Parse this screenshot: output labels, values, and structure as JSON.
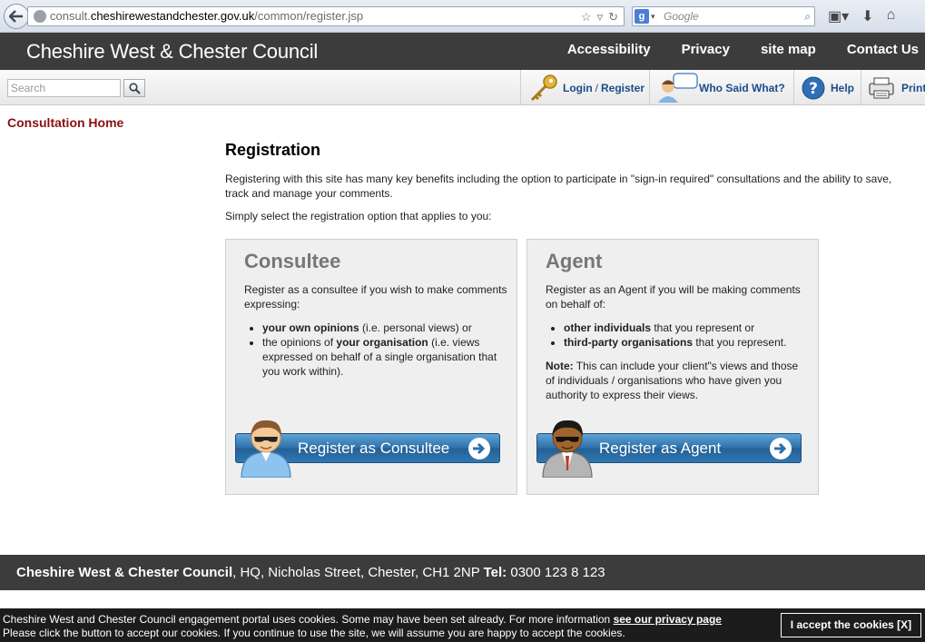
{
  "browser": {
    "url_prefix": "consult.",
    "url_host": "cheshirewestandchester.gov.uk",
    "url_path": "/common/register.jsp",
    "search_engine_letter": "g",
    "search_placeholder": "Google"
  },
  "header": {
    "site_title": "Cheshire West & Chester Council",
    "nav": [
      "Accessibility",
      "Privacy",
      "site map",
      "Contact Us"
    ]
  },
  "toolbar": {
    "search_placeholder": "Search",
    "login": "Login",
    "login_sep": "/",
    "register": "Register",
    "who_said": "Who Said What?",
    "help": "Help",
    "print": "Print"
  },
  "left_nav": {
    "home_link": "Consultation Home"
  },
  "main": {
    "title": "Registration",
    "intro": "Registering with this site has many key benefits including the option to participate in \"sign-in required\" consultations and the ability to save, track and manage your comments.",
    "instruction": "Simply select the registration option that applies to you:"
  },
  "consultee": {
    "heading": "Consultee",
    "intro": "Register as a consultee if you wish to make comments expressing:",
    "bullet1_bold": "your own opinions",
    "bullet1_rest": " (i.e. personal views) or",
    "bullet2_pre": "the opinions of ",
    "bullet2_bold": "your organisation",
    "bullet2_rest": " (i.e. views expressed on behalf of a single organisation that you work within).",
    "button": "Register as Consultee"
  },
  "agent": {
    "heading": "Agent",
    "intro": "Register as an Agent if you will be making comments on behalf of:",
    "bullet1_bold": "other individuals",
    "bullet1_rest": " that you represent or",
    "bullet2_bold": "third-party organisations",
    "bullet2_rest": " that you represent.",
    "note_label": "Note:",
    "note_text": " This can include your client\"s views and those of individuals / organisations who have given you authority to express their views.",
    "button": "Register as Agent"
  },
  "footer": {
    "org": "Cheshire West & Chester Council",
    "address": ", HQ, Nicholas Street, Chester, CH1 2NP ",
    "tel_label": "Tel:",
    "tel": " 0300 123 8 123"
  },
  "cookie": {
    "line1": "Cheshire West and Chester Council engagement portal uses cookies. Some may have been set already. For more information ",
    "link": "see our privacy page",
    "line2": "Please click the button to accept our cookies. If you continue to use the site, we will assume you are happy to accept the cookies.",
    "accept": "I accept the cookies [X]"
  }
}
